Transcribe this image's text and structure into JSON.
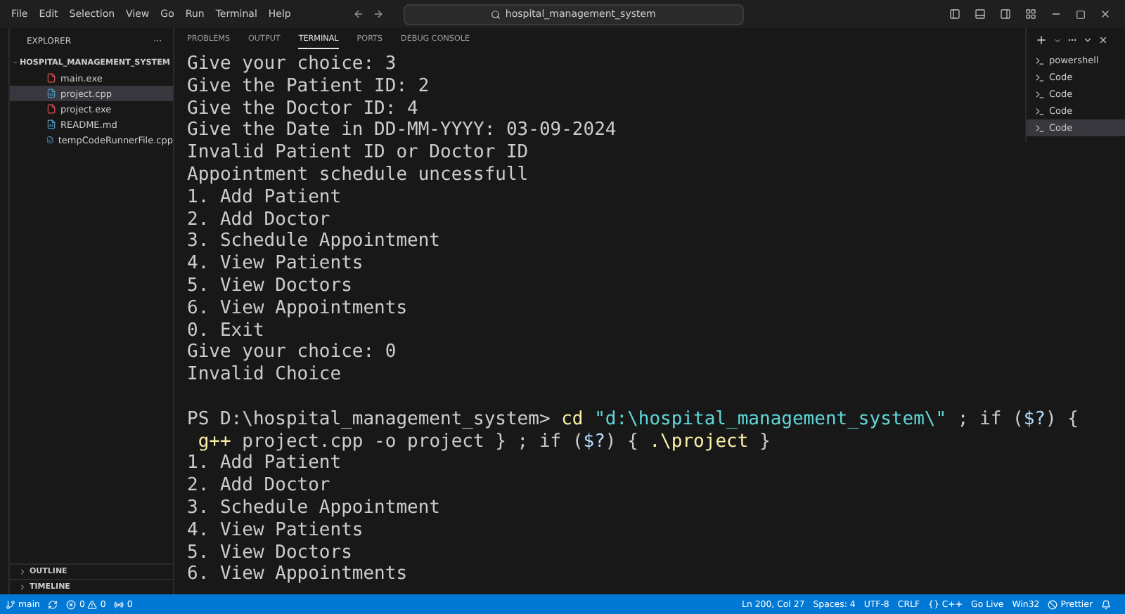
{
  "menu": [
    "File",
    "Edit",
    "Selection",
    "View",
    "Go",
    "Run",
    "Terminal",
    "Help"
  ],
  "search": {
    "value": "hospital_management_system"
  },
  "explorer": {
    "title": "EXPLORER",
    "more": "···",
    "folder": "HOSPITAL_MANAGEMENT_SYSTEM",
    "expanded": true,
    "files": [
      {
        "name": "main.exe",
        "kind": "exe",
        "selected": false
      },
      {
        "name": "project.cpp",
        "kind": "cpp",
        "selected": true
      },
      {
        "name": "project.exe",
        "kind": "exe",
        "selected": false
      },
      {
        "name": "README.md",
        "kind": "md",
        "selected": false
      },
      {
        "name": "tempCodeRunnerFile.cpp",
        "kind": "cpp",
        "selected": false
      }
    ],
    "sections": [
      "OUTLINE",
      "TIMELINE"
    ]
  },
  "panel_tabs": [
    {
      "label": "PROBLEMS",
      "selected": false
    },
    {
      "label": "OUTPUT",
      "selected": false
    },
    {
      "label": "TERMINAL",
      "selected": true
    },
    {
      "label": "PORTS",
      "selected": false
    },
    {
      "label": "DEBUG CONSOLE",
      "selected": false
    }
  ],
  "terminal_lines": [
    {
      "segments": [
        {
          "text": "Give your choice: 3",
          "kind": "plain"
        }
      ]
    },
    {
      "segments": [
        {
          "text": "Give the Patient ID: 2",
          "kind": "plain"
        }
      ]
    },
    {
      "segments": [
        {
          "text": "Give the Doctor ID: 4",
          "kind": "plain"
        }
      ]
    },
    {
      "segments": [
        {
          "text": "Give the Date in DD-MM-YYYY: 03-09-2024",
          "kind": "plain"
        }
      ]
    },
    {
      "segments": [
        {
          "text": "Invalid Patient ID or Doctor ID",
          "kind": "plain"
        }
      ]
    },
    {
      "segments": [
        {
          "text": "Appointment schedule uncessfull",
          "kind": "plain"
        }
      ]
    },
    {
      "segments": [
        {
          "text": "1. Add Patient",
          "kind": "plain"
        }
      ]
    },
    {
      "segments": [
        {
          "text": "2. Add Doctor",
          "kind": "plain"
        }
      ]
    },
    {
      "segments": [
        {
          "text": "3. Schedule Appointment",
          "kind": "plain"
        }
      ]
    },
    {
      "segments": [
        {
          "text": "4. View Patients",
          "kind": "plain"
        }
      ]
    },
    {
      "segments": [
        {
          "text": "5. View Doctors",
          "kind": "plain"
        }
      ]
    },
    {
      "segments": [
        {
          "text": "6. View Appointments",
          "kind": "plain"
        }
      ]
    },
    {
      "segments": [
        {
          "text": "0. Exit",
          "kind": "plain"
        }
      ]
    },
    {
      "segments": [
        {
          "text": "Give your choice: 0",
          "kind": "plain"
        }
      ]
    },
    {
      "segments": [
        {
          "text": "Invalid Choice",
          "kind": "plain"
        }
      ]
    },
    {
      "blank_before": true,
      "segments": [
        {
          "text": "PS D:\\hospital_management_system> ",
          "kind": "plain"
        },
        {
          "text": "cd",
          "kind": "command"
        },
        {
          "text": " \"d:\\hospital_management_system\\\"",
          "kind": "string"
        },
        {
          "text": " ; if (",
          "kind": "plain"
        },
        {
          "text": "$?",
          "kind": "variable"
        },
        {
          "text": ") {",
          "kind": "plain"
        }
      ]
    },
    {
      "segments": [
        {
          "text": " g++",
          "kind": "command"
        },
        {
          "text": " project.cpp -o project } ; if (",
          "kind": "plain"
        },
        {
          "text": "$?",
          "kind": "variable"
        },
        {
          "text": ") { ",
          "kind": "plain"
        },
        {
          "text": ".\\project",
          "kind": "command"
        },
        {
          "text": " }",
          "kind": "plain"
        }
      ]
    },
    {
      "segments": [
        {
          "text": "1. Add Patient",
          "kind": "plain"
        }
      ]
    },
    {
      "segments": [
        {
          "text": "2. Add Doctor",
          "kind": "plain"
        }
      ]
    },
    {
      "segments": [
        {
          "text": "3. Schedule Appointment",
          "kind": "plain"
        }
      ]
    },
    {
      "segments": [
        {
          "text": "4. View Patients",
          "kind": "plain"
        }
      ]
    },
    {
      "segments": [
        {
          "text": "5. View Doctors",
          "kind": "plain"
        }
      ]
    },
    {
      "segments": [
        {
          "text": "6. View Appointments",
          "kind": "plain"
        }
      ]
    }
  ],
  "terminals": [
    {
      "label": "powershell",
      "selected": false
    },
    {
      "label": "Code",
      "selected": false
    },
    {
      "label": "Code",
      "selected": false
    },
    {
      "label": "Code",
      "selected": false
    },
    {
      "label": "Code",
      "selected": true
    }
  ],
  "status_bar": {
    "branch": "main",
    "errors": "0",
    "warnings": "0",
    "ports": "0",
    "right": [
      "Ln 200, Col 27",
      "Spaces: 4",
      "UTF-8",
      "CRLF",
      "{} C++",
      "Go Live",
      "Win32",
      "Prettier"
    ]
  }
}
